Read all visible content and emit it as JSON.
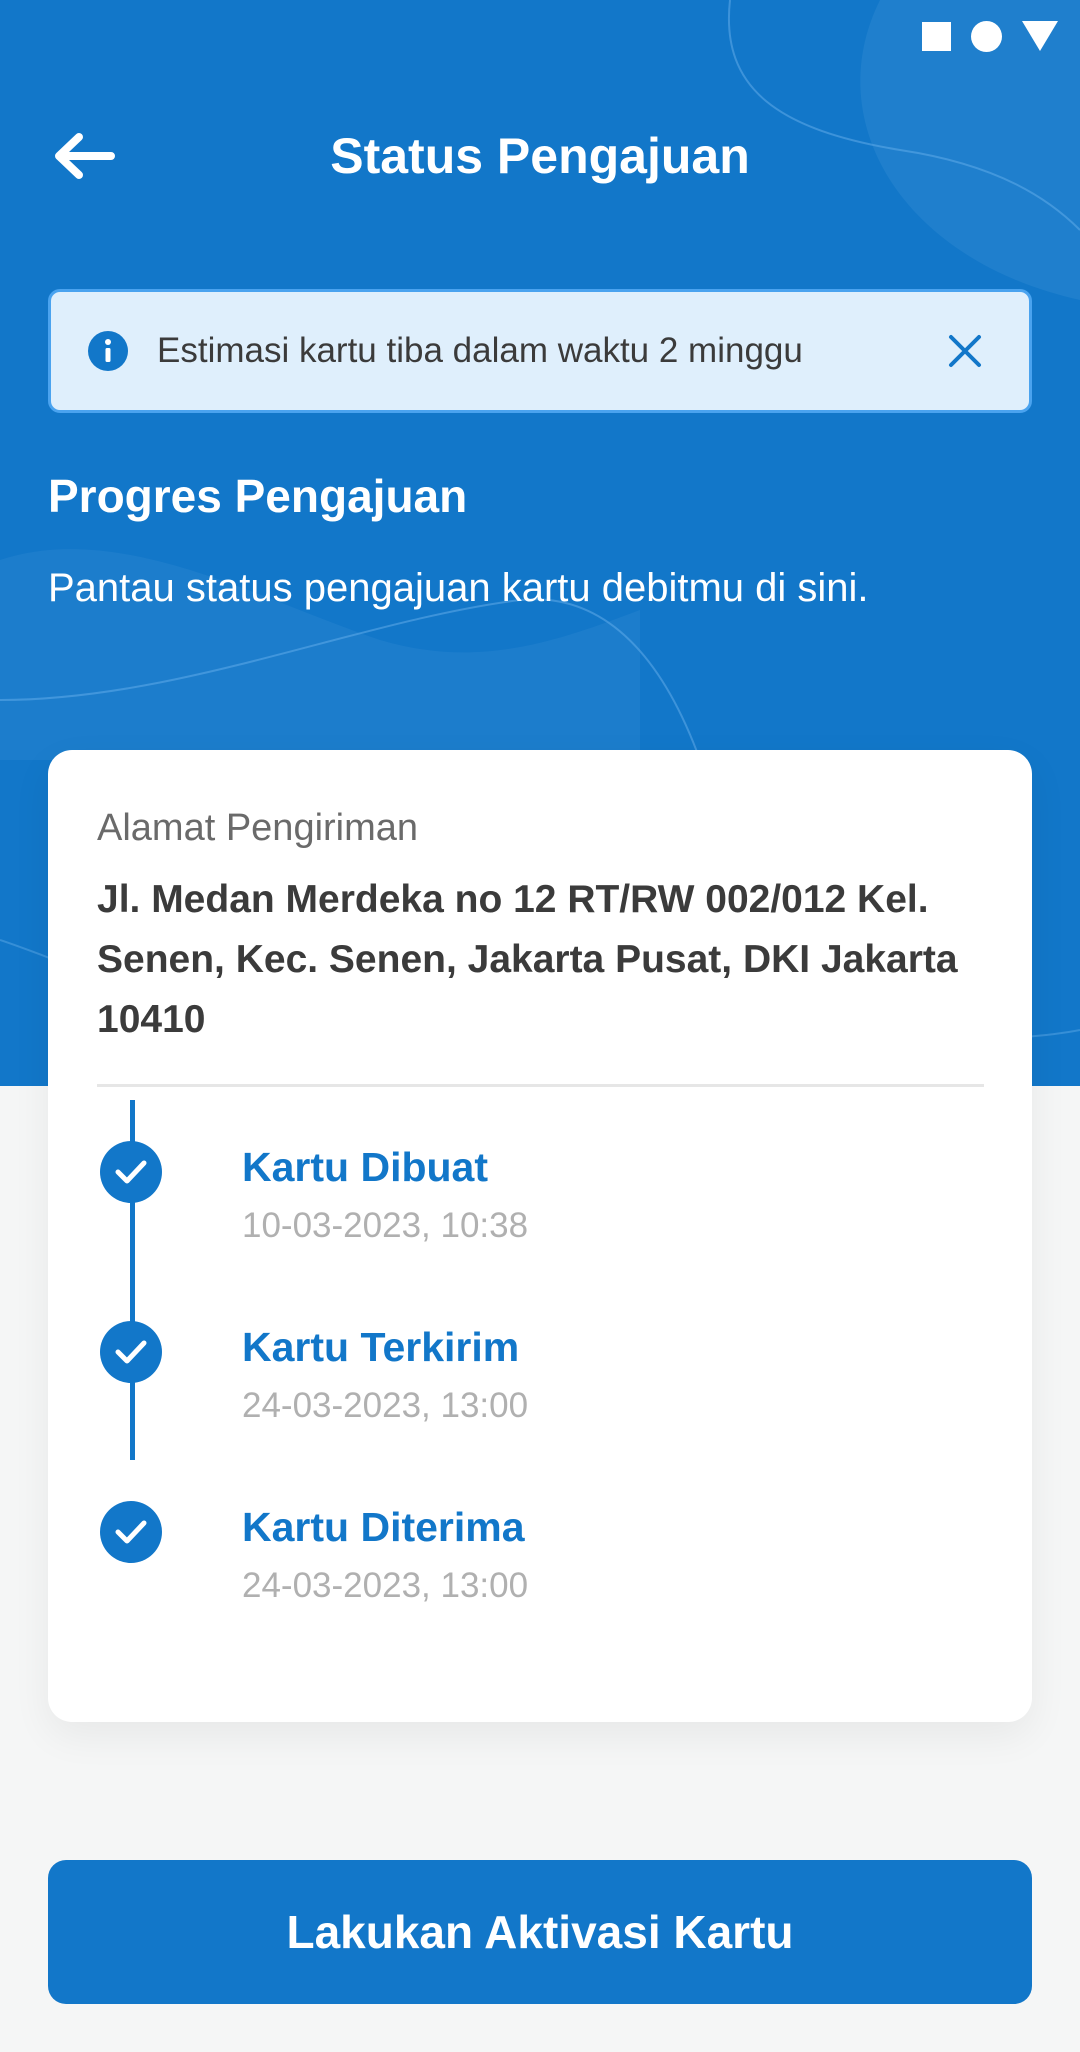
{
  "header": {
    "title": "Status Pengajuan",
    "back_icon": "arrow-left-icon"
  },
  "status_bar": {
    "icons": [
      "square-icon",
      "circle-icon",
      "triangle-icon"
    ]
  },
  "info_banner": {
    "text": "Estimasi kartu tiba dalam waktu 2 minggu",
    "icon": "info-icon",
    "close_icon": "close-icon"
  },
  "progress": {
    "title": "Progres Pengajuan",
    "description": "Pantau status pengajuan kartu debitmu di sini."
  },
  "card": {
    "address_label": "Alamat Pengiriman",
    "address_value": "Jl. Medan Merdeka no 12 RT/RW 002/012 Kel. Senen, Kec. Senen, Jakarta Pusat, DKI Jakarta 10410",
    "steps": [
      {
        "title": "Kartu Dibuat",
        "time": "10-03-2023, 10:38"
      },
      {
        "title": "Kartu Terkirim",
        "time": "24-03-2023, 13:00"
      },
      {
        "title": "Kartu Diterima",
        "time": "24-03-2023, 13:00"
      }
    ]
  },
  "cta": {
    "label": "Lakukan Aktivasi Kartu"
  },
  "colors": {
    "primary": "#1277c9",
    "banner_bg": "#dfeffc",
    "banner_border": "#4aa3ef",
    "page_bg": "#f5f6f6",
    "muted_text": "#b0b0b0"
  }
}
